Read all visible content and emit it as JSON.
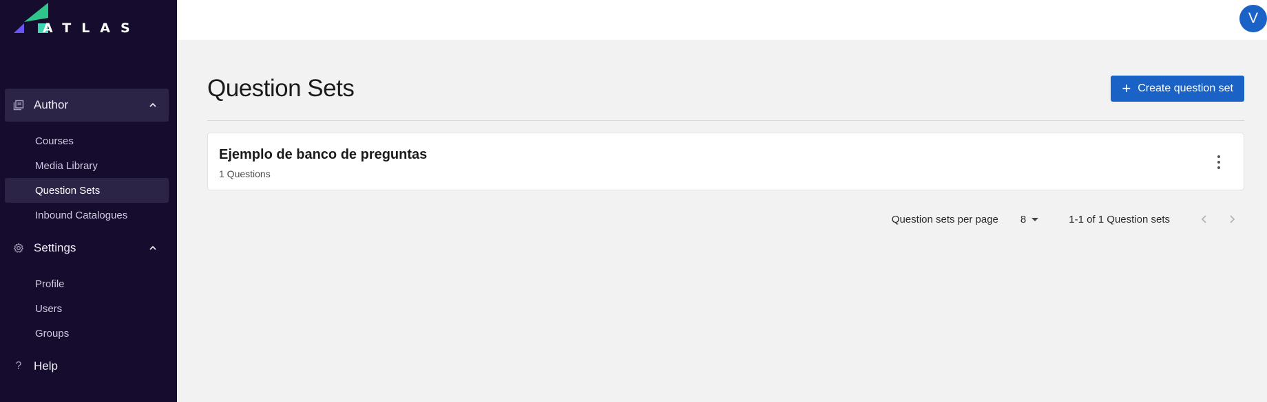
{
  "brand": {
    "name": "ATLAS"
  },
  "colors": {
    "sidebar_bg": "#150c2e",
    "accent": "#1a62c6",
    "logo_green": "#2fc48c",
    "logo_violet": "#6a55f0"
  },
  "sidebar": {
    "groups": [
      {
        "label": "Author",
        "icon": "library-icon",
        "expanded": true,
        "items": [
          {
            "label": "Courses"
          },
          {
            "label": "Media Library"
          },
          {
            "label": "Question Sets",
            "active": true
          },
          {
            "label": "Inbound Catalogues"
          }
        ]
      },
      {
        "label": "Settings",
        "icon": "gear-icon",
        "expanded": true,
        "items": [
          {
            "label": "Profile"
          },
          {
            "label": "Users"
          },
          {
            "label": "Groups"
          }
        ]
      }
    ],
    "help": {
      "label": "Help",
      "icon": "question-mark-icon"
    }
  },
  "topbar": {
    "avatar_initial": "V"
  },
  "main": {
    "title": "Question Sets",
    "create_button": {
      "label": "Create question set",
      "icon": "plus-icon"
    },
    "question_sets": [
      {
        "title": "Ejemplo de banco de preguntas",
        "subtitle": "1 Questions",
        "menu_icon": "more-vertical-icon"
      }
    ],
    "pagination": {
      "per_page_label": "Question sets per page",
      "per_page_value": "8",
      "range_text": "1-1 of 1 Question sets",
      "prev_icon": "chevron-left-icon",
      "next_icon": "chevron-right-icon"
    }
  }
}
